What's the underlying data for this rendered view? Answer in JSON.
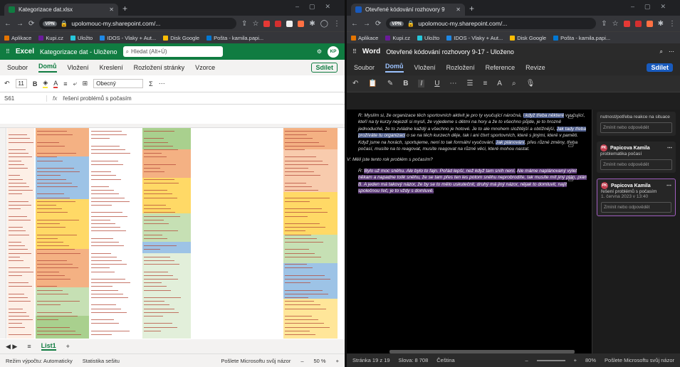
{
  "left": {
    "tab_title": "Kategorizace dat.xlsx",
    "url": "upolomouc-my.sharepoint.com/...",
    "bookmarks": [
      "Aplikace",
      "Kupi.cz",
      "Uložto",
      "IDOS - Vlaky + Aut...",
      "Disk Google",
      "Pošta - kamila.papi..."
    ],
    "app": "Excel",
    "doc_title": "Kategorizace dat - Uloženo",
    "search_ph": "Hledat (Alt+Ú)",
    "avatar": "KP",
    "menu": [
      "Soubor",
      "Domů",
      "Vložení",
      "Kreslení",
      "Rozložení stránky",
      "Vzorce"
    ],
    "share": "Sdílet",
    "font_size": "11",
    "bold": "B",
    "format": "Obecný",
    "cell_ref": "S61",
    "fx": "fx",
    "formula": "řešení problémů s počasím",
    "sheet": "List1",
    "status_calc": "Režim výpočtu: Automaticky",
    "status_stats": "Statistika sešitu",
    "feedback": "Pošlete Microsoftu svůj názor",
    "zoom": "50 %"
  },
  "right": {
    "tab_title": "Otevřené kódování rozhovory 9",
    "url": "upolomouc-my.sharepoint.com/...",
    "bookmarks": [
      "Aplikace",
      "Kupi.cz",
      "Uložto",
      "IDOS - Vlaky + Aut...",
      "Disk Google",
      "Pošta - kamila.papi..."
    ],
    "app": "Word",
    "doc_title": "Otevřené kódování rozhovory 9-17 - Uloženo",
    "menu": [
      "Soubor",
      "Domů",
      "Vložení",
      "Rozložení",
      "Reference",
      "Revize"
    ],
    "share": "Sdílet",
    "doc": {
      "p1": "R: Myslím si, že organizace těch sportovních aktivit je pro ty vyučující náročná, ",
      "p1_mark": "i když třeba některé",
      "p1b": " vyučující, kteří na ty kurzy nejezdí si myslí, že vyjedeme s dětmi na hory a že to všechno půjde, je to hrozně jednoduché, že to zvládne každý a všechno je hotové. Je to ale mnohem složitější a obtížnější, ",
      "p1_mark2": "Jak tady třeba prožíváte tu organizaci",
      "p1c": " o se na těch kurzech děje, tak i ani čtvrt sportovních, které s jinými, které v paměti. Když jsme na horách, sportujeme, není to tak formální vyučování, ",
      "p1_mark3": "Jak plánování",
      "p1d": ", přes různé změny, třeba počasí, musíte na to reagovat, musíte reagovat na různé věci, které mohou nastat.",
      "q": "V: Měli jste tento rok problém s počasím?",
      "p2": "R: ",
      "p2_mark": "Bylo už moc sněhu. Ale bylo to fajn. Pořád lepší, než když tam sníh není.",
      "p2b": " ",
      "p2_mark2": "Ale máme naplánovaný výlet někam a napadne tolik sněhu, že se tam přes ten les potom sněhu neprobrodíte, tak musíte mít jiný plán, plán B. A jeden má takový názor, že by se to mělo uskutečnit, druhý má jiný názor, nějak to domluvit, najít společnou řeč, je to vždy s domluvě."
    },
    "comments": [
      {
        "text": "nutnost/potřeba reakce na situace",
        "reply": "Zmínit nebo odpovědět"
      },
      {
        "author": "Papicova Kamila",
        "text": "problematika počasí",
        "reply": "Zmínit nebo odpovědět"
      },
      {
        "author": "Papicova Kamila",
        "text": "řešení problémů s počasím",
        "date": "1. června 2023 v 13:40",
        "reply": "Zmínit nebo odpovědět"
      }
    ],
    "status_page": "Stránka 19 z 19",
    "status_words": "Slova: 8 708",
    "status_lang": "Čeština",
    "zoom": "80%",
    "feedback": "Pošlete Microsoftu svůj názor"
  },
  "colors": {
    "excel_green": "#107c41",
    "word_blue": "#185abd",
    "comment_mark": "#5c3b78"
  }
}
